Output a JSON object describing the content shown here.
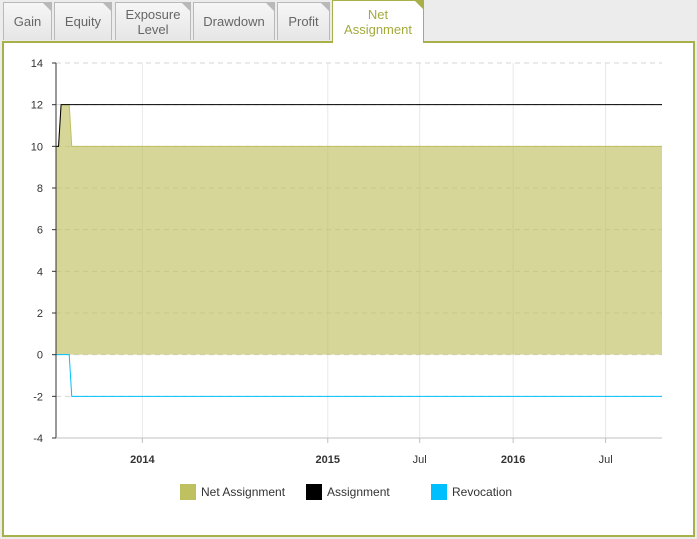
{
  "tabs": [
    {
      "label": "Gain",
      "active": false
    },
    {
      "label": "Equity",
      "active": false
    },
    {
      "label": "Exposure Level",
      "active": false
    },
    {
      "label": "Drawdown",
      "active": false
    },
    {
      "label": "Profit",
      "active": false
    },
    {
      "label": "Net Assignment",
      "active": true
    }
  ],
  "colors": {
    "accent": "#a8b04a",
    "net_assignment": "#bfc060",
    "assignment": "#000000",
    "revocation": "#00bfff"
  },
  "chart_data": {
    "type": "area",
    "ylim": [
      -4,
      14
    ],
    "yticks": [
      "14",
      "12",
      "10",
      "8",
      "6",
      "4",
      "2",
      "0",
      "-2",
      "-4"
    ],
    "xticks": [
      {
        "label": "2014",
        "date": "2014-01-01",
        "bold": true
      },
      {
        "label": "2015",
        "date": "2015-01-01",
        "bold": true
      },
      {
        "label": "Jul",
        "date": "2015-07-01",
        "bold": false
      },
      {
        "label": "2016",
        "date": "2016-01-01",
        "bold": true
      },
      {
        "label": "Jul",
        "date": "2016-07-01",
        "bold": false
      }
    ],
    "xlim": [
      "2013-07-15",
      "2016-10-20"
    ],
    "grid": true,
    "legend_position": "bottom",
    "series": [
      {
        "name": "Net Assignment",
        "type": "area",
        "color": "#bfc060",
        "points": [
          [
            "2013-07-15",
            10
          ],
          [
            "2013-07-20",
            10
          ],
          [
            "2013-07-25",
            12
          ],
          [
            "2013-08-10",
            12
          ],
          [
            "2013-08-15",
            10
          ],
          [
            "2016-10-20",
            10
          ]
        ]
      },
      {
        "name": "Assignment",
        "type": "line",
        "color": "#000000",
        "points": [
          [
            "2013-07-15",
            10
          ],
          [
            "2013-07-20",
            10
          ],
          [
            "2013-07-25",
            12
          ],
          [
            "2016-10-20",
            12
          ]
        ]
      },
      {
        "name": "Revocation",
        "type": "line",
        "color": "#00bfff",
        "points": [
          [
            "2013-07-15",
            0
          ],
          [
            "2013-08-10",
            0
          ],
          [
            "2013-08-15",
            -2
          ],
          [
            "2016-10-20",
            -2
          ]
        ]
      }
    ]
  },
  "legend": {
    "items": [
      {
        "label": "Net Assignment",
        "color": "#bfc060"
      },
      {
        "label": "Assignment",
        "color": "#000000"
      },
      {
        "label": "Revocation",
        "color": "#00bfff"
      }
    ]
  }
}
